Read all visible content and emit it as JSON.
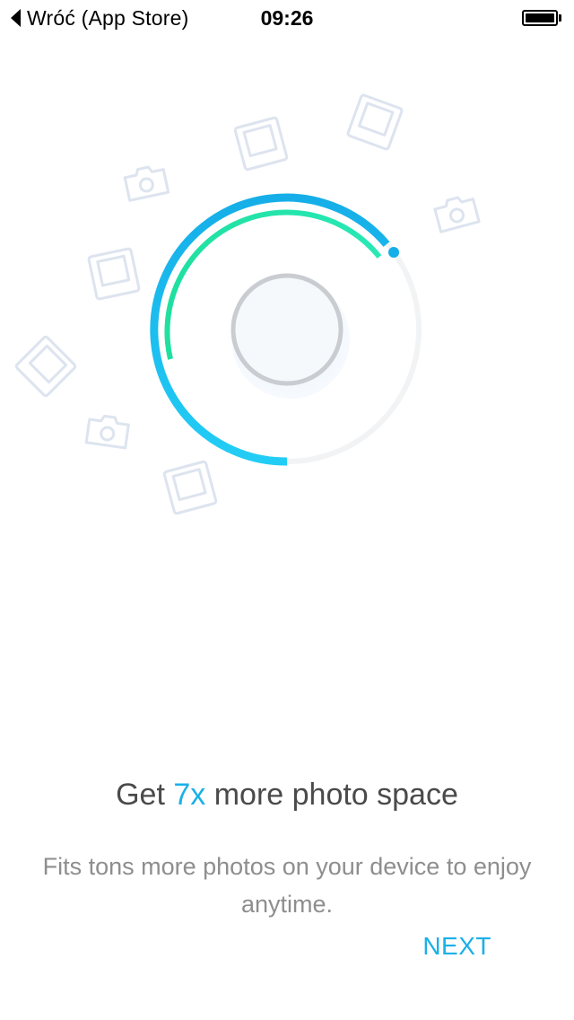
{
  "status_bar": {
    "back_label": "Wróć (App Store)",
    "time": "09:26",
    "battery_level": 1.0
  },
  "onboarding": {
    "headline_prefix": "Get ",
    "headline_highlight": "7x",
    "headline_suffix": " more photo space",
    "subtitle": "Fits tons more photos on your device to enjoy anytime.",
    "next_label": "NEXT"
  },
  "colors": {
    "accent_blue": "#1ab0e8",
    "accent_green": "#20e8a0",
    "track_gray": "#f2f2f2",
    "icon_outline": "#dde4ef"
  },
  "illustration": {
    "outer_ring_progress": 0.62,
    "inner_ring_progress": 0.5,
    "icons": [
      "photo-frame-icon",
      "camera-icon"
    ]
  }
}
